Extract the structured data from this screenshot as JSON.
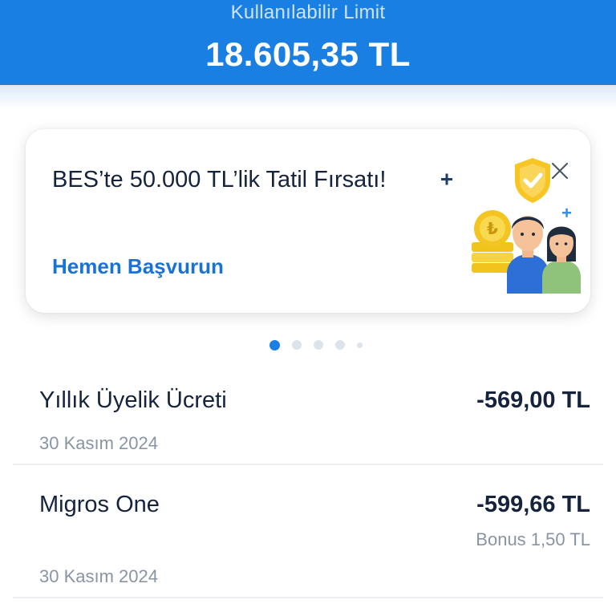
{
  "header": {
    "label": "Kullanılabilir Limit",
    "value": "18.605,35 TL"
  },
  "promo": {
    "title": "BES’te 50.000 TL’lik Tatil Fırsatı!",
    "cta": "Hemen Başvurun",
    "close_icon": "close-icon",
    "illustration": "family-savings-shield-illustration"
  },
  "carousel": {
    "total": 5,
    "active_index": 0
  },
  "transactions": [
    {
      "name": "Yıllık Üyelik Ücreti",
      "amount": "-569,00 TL",
      "date": "30 Kasım 2024"
    },
    {
      "name": "Migros One",
      "amount": "-599,66 TL",
      "bonus": "Bonus 1,50 TL",
      "date": "30 Kasım 2024"
    }
  ],
  "colors": {
    "brand_blue": "#1a7fe3",
    "link_blue": "#1a72d4",
    "text_dark": "#15233d",
    "text_muted": "#8a94a3"
  }
}
